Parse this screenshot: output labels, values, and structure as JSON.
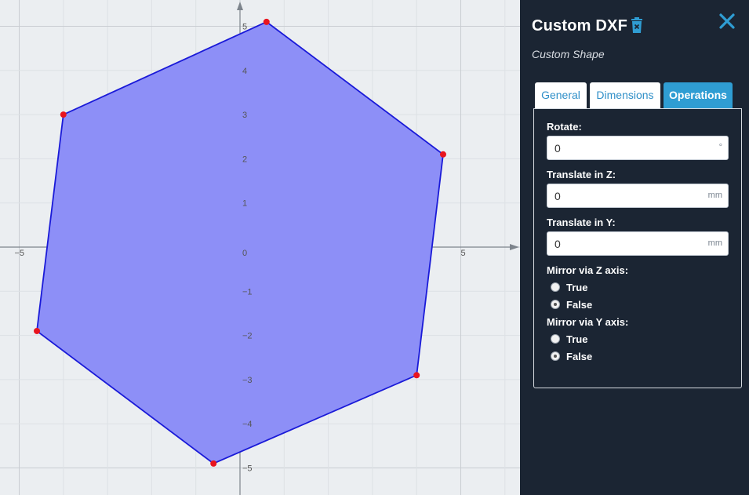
{
  "panel": {
    "title": "Custom DXF",
    "subtitle": "Custom Shape",
    "tabs": [
      {
        "label": "General",
        "active": false
      },
      {
        "label": "Dimensions",
        "active": false
      },
      {
        "label": "Operations",
        "active": true
      }
    ],
    "fields": [
      {
        "label": "Rotate:",
        "value": "0",
        "unit": "°"
      },
      {
        "label": "Translate in Z:",
        "value": "0",
        "unit": "mm"
      },
      {
        "label": "Translate in Y:",
        "value": "0",
        "unit": "mm"
      }
    ],
    "mirror_z": {
      "label": "Mirror via Z axis:",
      "options": [
        "True",
        "False"
      ],
      "selected": "False"
    },
    "mirror_y": {
      "label": "Mirror via Y axis:",
      "options": [
        "True",
        "False"
      ],
      "selected": "False"
    },
    "accent_color": "#2f9dd3"
  },
  "chart_data": {
    "type": "scatter",
    "x_ticks": [
      "−5",
      "0",
      "5"
    ],
    "y_ticks": [
      "5",
      "4",
      "3",
      "2",
      "1",
      "0",
      "−1",
      "−2",
      "−3",
      "−4",
      "−5"
    ],
    "polygon": [
      {
        "x": 0.6,
        "y": 5.1
      },
      {
        "x": 4.6,
        "y": 2.1
      },
      {
        "x": 4.0,
        "y": -2.9
      },
      {
        "x": -0.6,
        "y": -4.9
      },
      {
        "x": -4.6,
        "y": -1.9
      },
      {
        "x": -4.0,
        "y": 3.0
      }
    ],
    "fill_color": "#8d8ff7",
    "stroke_color": "#1a1ad8",
    "vertex_color": "#e8141e",
    "grid": true
  }
}
